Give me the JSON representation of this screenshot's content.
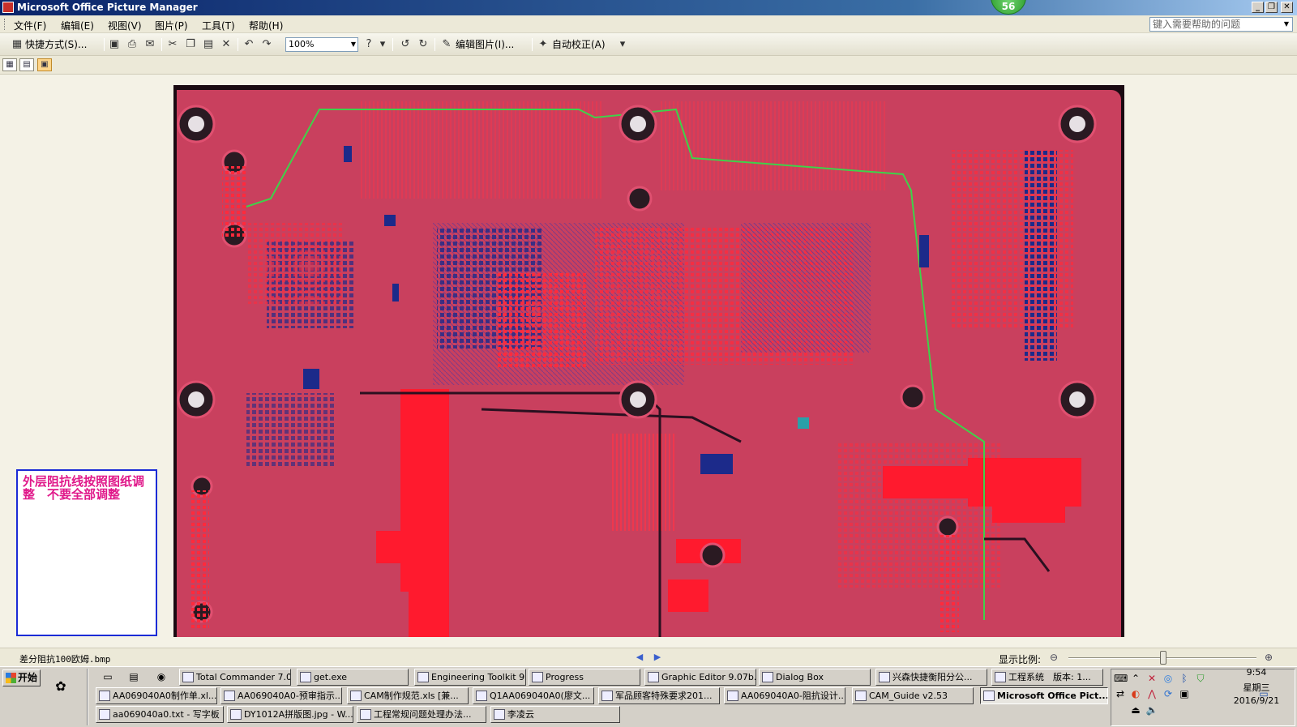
{
  "window": {
    "title": "Microsoft Office Picture Manager",
    "notification_count": "56",
    "controls": [
      "_",
      "❐",
      "✕"
    ]
  },
  "menu": {
    "items": [
      "文件(F)",
      "编辑(E)",
      "视图(V)",
      "图片(P)",
      "工具(T)",
      "帮助(H)"
    ],
    "help_placeholder": "键入需要帮助的问题"
  },
  "toolbar": {
    "shortcuts_label": "快捷方式(S)...",
    "zoom_value": "100%",
    "edit_picture_label": "编辑图片(I)...",
    "auto_correct_label": "自动校正(A)"
  },
  "note": {
    "text": "外层阻抗线按照图纸调整　不要全部调整"
  },
  "status": {
    "filename": "差分阻抗100欧姆.bmp",
    "zoom_label": "显示比例:"
  },
  "taskbar": {
    "start_label": "开始",
    "row1": [
      {
        "label": "Total Commander 7.0...",
        "icon": "tc-icon"
      },
      {
        "label": "get.exe",
        "icon": "globe-icon"
      },
      {
        "label": "Engineering Toolkit 9...",
        "icon": "app-icon"
      },
      {
        "label": "Progress",
        "icon": "app-icon"
      },
      {
        "label": "Graphic Editor 9.07b...",
        "icon": "app-icon"
      },
      {
        "label": "Dialog Box",
        "icon": "app-icon"
      },
      {
        "label": "兴森快捷衡阳分公...",
        "icon": "star-icon"
      },
      {
        "label": "工程系统　版本: 1...",
        "icon": "app-icon"
      }
    ],
    "row2": [
      {
        "label": "AA069040A0制作单.xl...",
        "icon": "excel-icon"
      },
      {
        "label": "AA069040A0-预审指示...",
        "icon": "excel-icon"
      },
      {
        "label": "CAM制作规范.xls [兼...",
        "icon": "excel-icon"
      },
      {
        "label": "Q1AA069040A0(廖文...",
        "icon": "excel-icon"
      },
      {
        "label": "军品顾客特殊要求201...",
        "icon": "word-icon"
      },
      {
        "label": "AA069040A0-阻抗设计...",
        "icon": "word-icon"
      },
      {
        "label": "CAM_Guide v2.53",
        "icon": "app-icon"
      },
      {
        "label": "Microsoft Office Pict...",
        "icon": "picture-icon"
      }
    ],
    "row3": [
      {
        "label": "aa069040a0.txt - 写字板",
        "icon": "wordpad-icon"
      },
      {
        "label": "DY1012A拼版图.jpg - W...",
        "icon": "picture-icon"
      },
      {
        "label": "工程常规问题处理办法...",
        "icon": "pdf-icon"
      },
      {
        "label": "李凌云",
        "icon": "qq-icon"
      }
    ],
    "clock_time": "9:54",
    "clock_day": "星期三",
    "clock_date": "2016/9/21"
  },
  "colors": {
    "pcb_board": "#c9405e",
    "note_border": "#1b2bd6",
    "note_text": "#e0188a"
  }
}
